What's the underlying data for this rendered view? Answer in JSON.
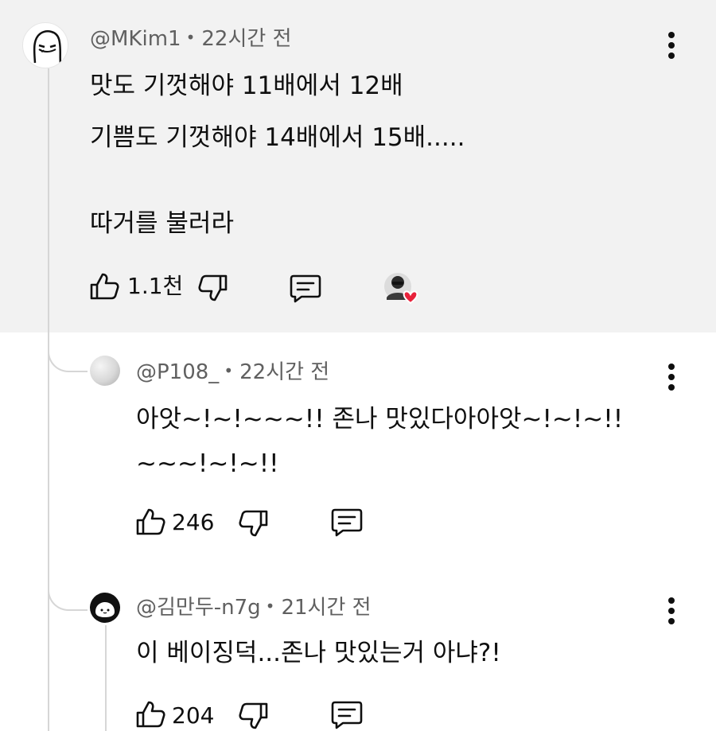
{
  "comment": {
    "author": "@MKim1",
    "time": "22시간 전",
    "lines": [
      "맛도 기껏해야 11배에서 12배",
      "기쁨도 기껏해야 14배에서 15배.....",
      "따거를 불러라"
    ],
    "like_count": "1.1천",
    "icons": [
      "thumbs-up-icon",
      "thumbs-down-icon",
      "reply-icon",
      "creator-heart-icon",
      "more-options-icon"
    ]
  },
  "replies": [
    {
      "author": "@P108_",
      "time": "22시간 전",
      "lines": [
        "아앗~!~!~~~!! 존나 맛있다아아앗~!~!~!!",
        "~~~!~!~!!"
      ],
      "like_count": "246"
    },
    {
      "author": "@김만두-n7g",
      "time": "21시간 전",
      "lines": [
        "이 베이징덕...존나 맛있는거 아냐?!"
      ],
      "like_count": "204"
    }
  ],
  "colors": {
    "highlight_bg": "#f2f2f2",
    "heart": "#e8223b",
    "meta_text": "#606060"
  }
}
